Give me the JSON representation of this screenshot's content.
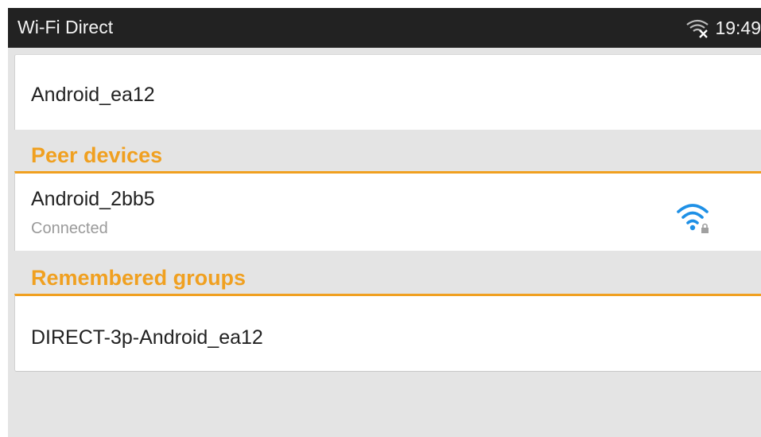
{
  "status_bar": {
    "title": "Wi-Fi Direct",
    "time": "19:49",
    "wifi_icon": "wifi-off-icon"
  },
  "device": {
    "name": "Android_ea12"
  },
  "peer_section": {
    "header": "Peer devices",
    "items": [
      {
        "name": "Android_2bb5",
        "status": "Connected",
        "icon": "wifi-signal-locked-icon"
      }
    ]
  },
  "groups_section": {
    "header": "Remembered groups",
    "items": [
      {
        "name": "DIRECT-3p-Android_ea12"
      }
    ]
  },
  "colors": {
    "accent": "#f0a020",
    "status_bar": "#222222",
    "background": "#e4e4e4",
    "signal": "#1e90e6"
  }
}
